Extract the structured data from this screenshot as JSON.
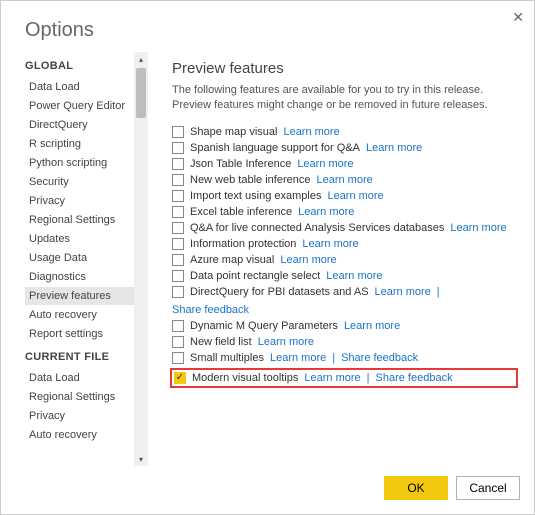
{
  "window": {
    "title": "Options"
  },
  "sidebar": {
    "sections": [
      {
        "header": "GLOBAL",
        "items": [
          {
            "label": "Data Load",
            "selected": false
          },
          {
            "label": "Power Query Editor",
            "selected": false
          },
          {
            "label": "DirectQuery",
            "selected": false
          },
          {
            "label": "R scripting",
            "selected": false
          },
          {
            "label": "Python scripting",
            "selected": false
          },
          {
            "label": "Security",
            "selected": false
          },
          {
            "label": "Privacy",
            "selected": false
          },
          {
            "label": "Regional Settings",
            "selected": false
          },
          {
            "label": "Updates",
            "selected": false
          },
          {
            "label": "Usage Data",
            "selected": false
          },
          {
            "label": "Diagnostics",
            "selected": false
          },
          {
            "label": "Preview features",
            "selected": true
          },
          {
            "label": "Auto recovery",
            "selected": false
          },
          {
            "label": "Report settings",
            "selected": false
          }
        ]
      },
      {
        "header": "CURRENT FILE",
        "items": [
          {
            "label": "Data Load",
            "selected": false
          },
          {
            "label": "Regional Settings",
            "selected": false
          },
          {
            "label": "Privacy",
            "selected": false
          },
          {
            "label": "Auto recovery",
            "selected": false
          }
        ]
      }
    ]
  },
  "content": {
    "header": "Preview features",
    "description": "The following features are available for you to try in this release. Preview features might change or be removed in future releases.",
    "learn_more": "Learn more",
    "share_feedback": "Share feedback",
    "features": [
      {
        "label": "Shape map visual",
        "checked": false,
        "learn_more": true,
        "share_feedback": false,
        "highlighted": false
      },
      {
        "label": "Spanish language support for Q&A",
        "checked": false,
        "learn_more": true,
        "share_feedback": false,
        "highlighted": false
      },
      {
        "label": "Json Table Inference",
        "checked": false,
        "learn_more": true,
        "share_feedback": false,
        "highlighted": false
      },
      {
        "label": "New web table inference",
        "checked": false,
        "learn_more": true,
        "share_feedback": false,
        "highlighted": false
      },
      {
        "label": "Import text using examples",
        "checked": false,
        "learn_more": true,
        "share_feedback": false,
        "highlighted": false
      },
      {
        "label": "Excel table inference",
        "checked": false,
        "learn_more": true,
        "share_feedback": false,
        "highlighted": false
      },
      {
        "label": "Q&A for live connected Analysis Services databases",
        "checked": false,
        "learn_more": true,
        "share_feedback": false,
        "highlighted": false
      },
      {
        "label": "Information protection",
        "checked": false,
        "learn_more": true,
        "share_feedback": false,
        "highlighted": false
      },
      {
        "label": "Azure map visual",
        "checked": false,
        "learn_more": true,
        "share_feedback": false,
        "highlighted": false
      },
      {
        "label": "Data point rectangle select",
        "checked": false,
        "learn_more": true,
        "share_feedback": false,
        "highlighted": false
      },
      {
        "label": "DirectQuery for PBI datasets and AS",
        "checked": false,
        "learn_more": true,
        "share_feedback": true,
        "highlighted": false
      },
      {
        "label": "Dynamic M Query Parameters",
        "checked": false,
        "learn_more": true,
        "share_feedback": false,
        "highlighted": false
      },
      {
        "label": "New field list",
        "checked": false,
        "learn_more": true,
        "share_feedback": false,
        "highlighted": false
      },
      {
        "label": "Small multiples",
        "checked": false,
        "learn_more": true,
        "share_feedback": true,
        "highlighted": false
      },
      {
        "label": "Modern visual tooltips",
        "checked": true,
        "learn_more": true,
        "share_feedback": true,
        "highlighted": true
      }
    ]
  },
  "footer": {
    "ok": "OK",
    "cancel": "Cancel"
  }
}
